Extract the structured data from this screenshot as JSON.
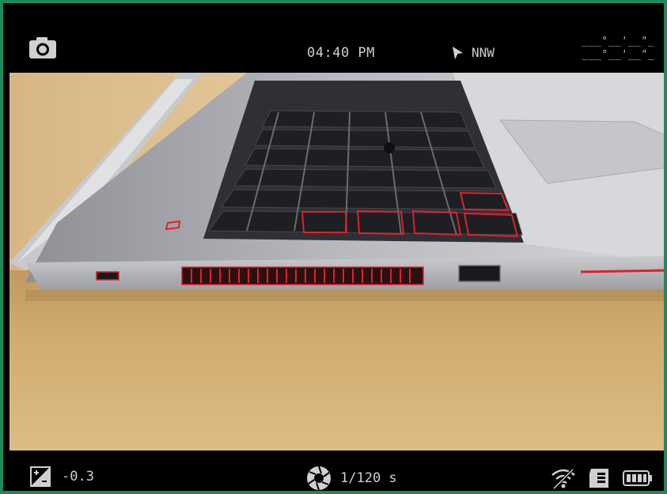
{
  "topbar": {
    "camera_icon": "camera-icon",
    "time": "04:40 PM",
    "heading_icon": "navigation-arrow-icon",
    "heading": "NNW",
    "latitude": "___°__'__\"_",
    "longitude": "___°__'__\"_"
  },
  "viewfinder": {
    "subject": "laptop-photo"
  },
  "bottombar": {
    "exposure_icon": "exposure-compensation-icon",
    "exposure_value": "-0.3",
    "aperture_icon": "aperture-icon",
    "shutter_speed": "1/120 s",
    "wifi_icon": "wifi-off-icon",
    "sd_icon": "sd-card-icon",
    "battery_icon": "battery-icon"
  },
  "colors": {
    "border": "#1d8a5c",
    "bar_bg": "#000000",
    "text": "#cfcfcf",
    "highlight_red": "#e0202a"
  }
}
